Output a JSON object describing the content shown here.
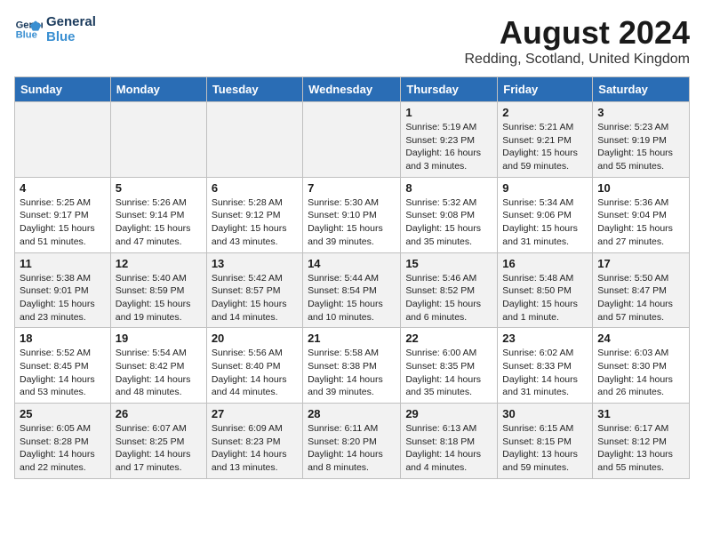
{
  "logo": {
    "line1": "General",
    "line2": "Blue"
  },
  "title": "August 2024",
  "location": "Redding, Scotland, United Kingdom",
  "days_header": [
    "Sunday",
    "Monday",
    "Tuesday",
    "Wednesday",
    "Thursday",
    "Friday",
    "Saturday"
  ],
  "weeks": [
    [
      {
        "day": "",
        "info": ""
      },
      {
        "day": "",
        "info": ""
      },
      {
        "day": "",
        "info": ""
      },
      {
        "day": "",
        "info": ""
      },
      {
        "day": "1",
        "info": "Sunrise: 5:19 AM\nSunset: 9:23 PM\nDaylight: 16 hours\nand 3 minutes."
      },
      {
        "day": "2",
        "info": "Sunrise: 5:21 AM\nSunset: 9:21 PM\nDaylight: 15 hours\nand 59 minutes."
      },
      {
        "day": "3",
        "info": "Sunrise: 5:23 AM\nSunset: 9:19 PM\nDaylight: 15 hours\nand 55 minutes."
      }
    ],
    [
      {
        "day": "4",
        "info": "Sunrise: 5:25 AM\nSunset: 9:17 PM\nDaylight: 15 hours\nand 51 minutes."
      },
      {
        "day": "5",
        "info": "Sunrise: 5:26 AM\nSunset: 9:14 PM\nDaylight: 15 hours\nand 47 minutes."
      },
      {
        "day": "6",
        "info": "Sunrise: 5:28 AM\nSunset: 9:12 PM\nDaylight: 15 hours\nand 43 minutes."
      },
      {
        "day": "7",
        "info": "Sunrise: 5:30 AM\nSunset: 9:10 PM\nDaylight: 15 hours\nand 39 minutes."
      },
      {
        "day": "8",
        "info": "Sunrise: 5:32 AM\nSunset: 9:08 PM\nDaylight: 15 hours\nand 35 minutes."
      },
      {
        "day": "9",
        "info": "Sunrise: 5:34 AM\nSunset: 9:06 PM\nDaylight: 15 hours\nand 31 minutes."
      },
      {
        "day": "10",
        "info": "Sunrise: 5:36 AM\nSunset: 9:04 PM\nDaylight: 15 hours\nand 27 minutes."
      }
    ],
    [
      {
        "day": "11",
        "info": "Sunrise: 5:38 AM\nSunset: 9:01 PM\nDaylight: 15 hours\nand 23 minutes."
      },
      {
        "day": "12",
        "info": "Sunrise: 5:40 AM\nSunset: 8:59 PM\nDaylight: 15 hours\nand 19 minutes."
      },
      {
        "day": "13",
        "info": "Sunrise: 5:42 AM\nSunset: 8:57 PM\nDaylight: 15 hours\nand 14 minutes."
      },
      {
        "day": "14",
        "info": "Sunrise: 5:44 AM\nSunset: 8:54 PM\nDaylight: 15 hours\nand 10 minutes."
      },
      {
        "day": "15",
        "info": "Sunrise: 5:46 AM\nSunset: 8:52 PM\nDaylight: 15 hours\nand 6 minutes."
      },
      {
        "day": "16",
        "info": "Sunrise: 5:48 AM\nSunset: 8:50 PM\nDaylight: 15 hours\nand 1 minute."
      },
      {
        "day": "17",
        "info": "Sunrise: 5:50 AM\nSunset: 8:47 PM\nDaylight: 14 hours\nand 57 minutes."
      }
    ],
    [
      {
        "day": "18",
        "info": "Sunrise: 5:52 AM\nSunset: 8:45 PM\nDaylight: 14 hours\nand 53 minutes."
      },
      {
        "day": "19",
        "info": "Sunrise: 5:54 AM\nSunset: 8:42 PM\nDaylight: 14 hours\nand 48 minutes."
      },
      {
        "day": "20",
        "info": "Sunrise: 5:56 AM\nSunset: 8:40 PM\nDaylight: 14 hours\nand 44 minutes."
      },
      {
        "day": "21",
        "info": "Sunrise: 5:58 AM\nSunset: 8:38 PM\nDaylight: 14 hours\nand 39 minutes."
      },
      {
        "day": "22",
        "info": "Sunrise: 6:00 AM\nSunset: 8:35 PM\nDaylight: 14 hours\nand 35 minutes."
      },
      {
        "day": "23",
        "info": "Sunrise: 6:02 AM\nSunset: 8:33 PM\nDaylight: 14 hours\nand 31 minutes."
      },
      {
        "day": "24",
        "info": "Sunrise: 6:03 AM\nSunset: 8:30 PM\nDaylight: 14 hours\nand 26 minutes."
      }
    ],
    [
      {
        "day": "25",
        "info": "Sunrise: 6:05 AM\nSunset: 8:28 PM\nDaylight: 14 hours\nand 22 minutes."
      },
      {
        "day": "26",
        "info": "Sunrise: 6:07 AM\nSunset: 8:25 PM\nDaylight: 14 hours\nand 17 minutes."
      },
      {
        "day": "27",
        "info": "Sunrise: 6:09 AM\nSunset: 8:23 PM\nDaylight: 14 hours\nand 13 minutes."
      },
      {
        "day": "28",
        "info": "Sunrise: 6:11 AM\nSunset: 8:20 PM\nDaylight: 14 hours\nand 8 minutes."
      },
      {
        "day": "29",
        "info": "Sunrise: 6:13 AM\nSunset: 8:18 PM\nDaylight: 14 hours\nand 4 minutes."
      },
      {
        "day": "30",
        "info": "Sunrise: 6:15 AM\nSunset: 8:15 PM\nDaylight: 13 hours\nand 59 minutes."
      },
      {
        "day": "31",
        "info": "Sunrise: 6:17 AM\nSunset: 8:12 PM\nDaylight: 13 hours\nand 55 minutes."
      }
    ]
  ]
}
